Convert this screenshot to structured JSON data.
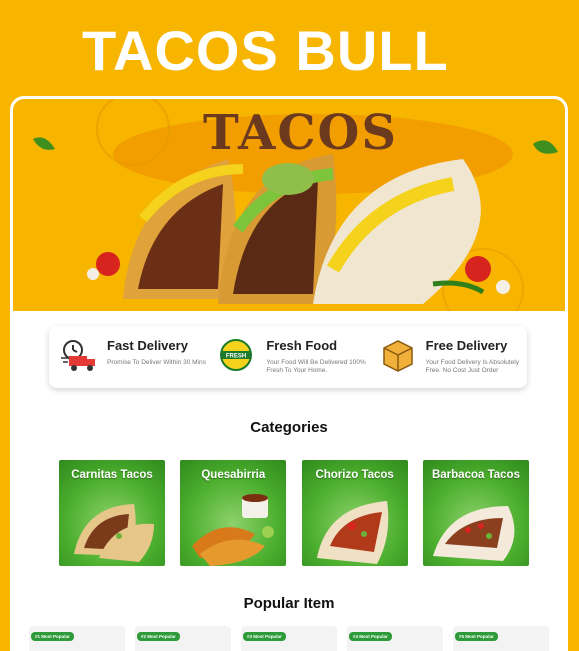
{
  "brand": {
    "title": "TACOS BULL"
  },
  "hero": {
    "title": "TACOS"
  },
  "colors": {
    "background": "#f7b500",
    "accent_green": "#2e9b3a",
    "hero_text": "#6b3a1e"
  },
  "features": [
    {
      "icon": "delivery-truck-icon",
      "title": "Fast Delivery",
      "desc": "Promise To Deliver Within 30 Mins"
    },
    {
      "icon": "fresh-badge-icon",
      "title": "Fresh Food",
      "desc": "Your Food Will Be Delivered 100% Fresh To Your Home."
    },
    {
      "icon": "package-box-icon",
      "title": "Free Delivery",
      "desc": "Your Food Delivery Is Absolutely Free. No Cost Just Order"
    }
  ],
  "fresh_badge_text": "FRESH",
  "categories": {
    "title": "Categories",
    "items": [
      {
        "label": "Carnitas Tacos"
      },
      {
        "label": "Quesabirria"
      },
      {
        "label": "Chorizo Tacos"
      },
      {
        "label": "Barbacoa Tacos"
      }
    ]
  },
  "popular": {
    "title": "Popular Item",
    "items": [
      {
        "badge": "#1 Most Popular"
      },
      {
        "badge": "#2 Most Popular"
      },
      {
        "badge": "#3 Most Popular"
      },
      {
        "badge": "#4 Most Popular"
      },
      {
        "badge": "#5 Most Popular"
      }
    ]
  }
}
